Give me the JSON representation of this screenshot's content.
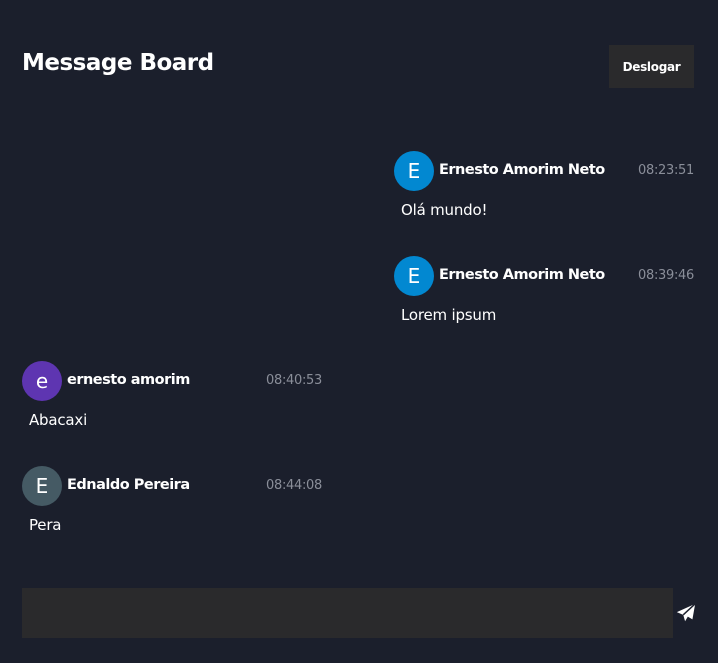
{
  "header": {
    "title": "Message Board",
    "logout_label": "Deslogar"
  },
  "messages": [
    {
      "initial": "E",
      "author": "Ernesto Amorim Neto",
      "time": "08:23:51",
      "text": "Olá mundo!",
      "avatar_color": "#0288d1",
      "side": "right"
    },
    {
      "initial": "E",
      "author": "Ernesto Amorim Neto",
      "time": "08:39:46",
      "text": "Lorem ipsum",
      "avatar_color": "#0288d1",
      "side": "right"
    },
    {
      "initial": "e",
      "author": "ernesto amorim",
      "time": "08:40:53",
      "text": "Abacaxi",
      "avatar_color": "#5e35b1",
      "side": "left"
    },
    {
      "initial": "E",
      "author": "Ednaldo Pereira",
      "time": "08:44:08",
      "text": "Pera",
      "avatar_color": "#455a64",
      "side": "left"
    }
  ],
  "composer": {
    "value": "",
    "placeholder": "",
    "send_icon": "send-icon"
  }
}
